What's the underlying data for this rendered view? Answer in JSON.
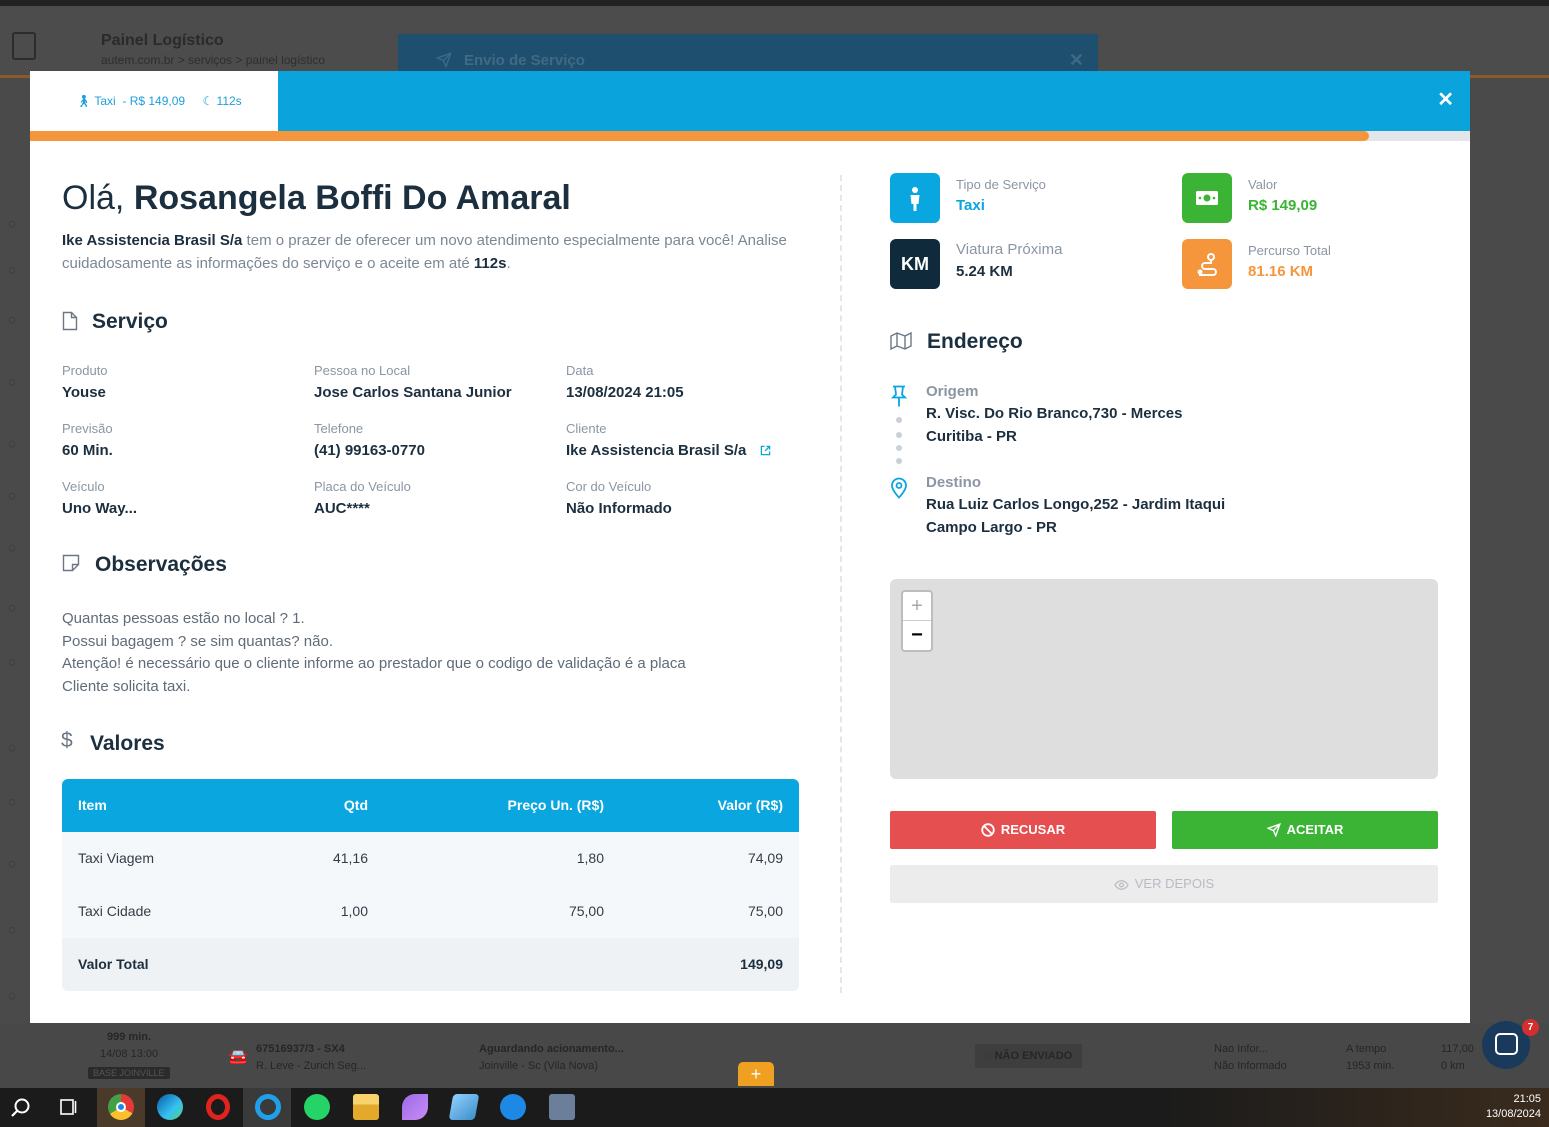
{
  "background": {
    "app_title": "Painel Logístico",
    "breadcrumb": "autem.com.br  >  serviços  >  painel logístico",
    "send_dialog_title": "Envio de Serviço",
    "bottom_row": {
      "time_min": "999 min.",
      "time_date": "14/08 13:00",
      "base_badge": "BASE JOINVILLE",
      "service_code": "67516937/3 - SX4",
      "service_address": "R. Leve - Zurich Seg...",
      "status": "Aguardando acionamento...",
      "city": "Joinville - Sc (Vila Nova)",
      "send_status": "NÃO ENVIADO",
      "info1_a": "Nao Infor...",
      "info1_b": "Não Informado",
      "info2_a": "A tempo",
      "info2_b": "1953 min.",
      "info3_a": "117,00",
      "info3_b": "0 km"
    },
    "chat_unread": "7"
  },
  "modal": {
    "tab": {
      "service": "Taxi",
      "price": "- R$ 149,09",
      "timer": "112s"
    },
    "progress_fraction": 0.93,
    "greeting_prefix": "Olá,",
    "greeting_name": "Rosangela Boffi Do Amaral",
    "intro": {
      "company": "Ike Assistencia Brasil S/a",
      "text": " tem o prazer de oferecer um novo atendimento especialmente para você! Analise cuidadosamente as informações do serviço e o aceite em até ",
      "deadline": "112s",
      "end": "."
    },
    "servico": {
      "title": "Serviço",
      "fields": {
        "produto": {
          "label": "Produto",
          "value": "Youse"
        },
        "pessoa": {
          "label": "Pessoa no Local",
          "value": "Jose Carlos Santana Junior"
        },
        "data": {
          "label": "Data",
          "value": "13/08/2024 21:05"
        },
        "previsao": {
          "label": "Previsão",
          "value": "60 Min."
        },
        "telefone": {
          "label": "Telefone",
          "value": "(41) 99163-0770"
        },
        "cliente": {
          "label": "Cliente",
          "value": "Ike Assistencia Brasil S/a"
        },
        "veiculo": {
          "label": "Veículo",
          "value": "Uno Way..."
        },
        "placa": {
          "label": "Placa do Veículo",
          "value": "AUC****"
        },
        "cor": {
          "label": "Cor do Veículo",
          "value": "Não Informado"
        }
      }
    },
    "observacoes": {
      "title": "Observações",
      "lines": [
        "Quantas pessoas estão no local ? 1.",
        "Possui bagagem ? se sim quantas? não.",
        "Atenção! é necessário que o cliente informe ao prestador que o codigo de validação é a placa",
        "Cliente solicita taxi."
      ]
    },
    "valores": {
      "title": "Valores",
      "headers": {
        "item": "Item",
        "qtd": "Qtd",
        "preco": "Preço Un. (R$)",
        "valor": "Valor (R$)"
      },
      "rows": [
        {
          "item": "Taxi Viagem",
          "qtd": "41,16",
          "preco": "1,80",
          "valor": "74,09"
        },
        {
          "item": "Taxi Cidade",
          "qtd": "1,00",
          "preco": "75,00",
          "valor": "75,00"
        }
      ],
      "total_label": "Valor Total",
      "total_value": "149,09"
    },
    "info_cards": {
      "tipo": {
        "label": "Tipo de Serviço",
        "value": "Taxi",
        "color": "#0aa6e0"
      },
      "valor": {
        "label": "Valor",
        "value": "R$ 149,09",
        "color": "#3bb436"
      },
      "viatura": {
        "label": "Viatura Próxima",
        "value": "5.24 KM",
        "badge_text": "KM",
        "color": "#0f2a3a"
      },
      "percurso": {
        "label": "Percurso Total",
        "value": "81.16 KM",
        "color": "#f5963c"
      }
    },
    "endereco": {
      "title": "Endereço",
      "origem_label": "Origem",
      "origem_line1": "R. Visc. Do Rio Branco,730 - Merces",
      "origem_line2": "Curitiba - PR",
      "destino_label": "Destino",
      "destino_line1": "Rua Luiz Carlos Longo,252 - Jardim Itaqui",
      "destino_line2": "Campo Largo - PR"
    },
    "map": {
      "zoom_in": "+",
      "zoom_out": "−"
    },
    "buttons": {
      "recusar": "RECUSAR",
      "aceitar": "ACEITAR",
      "ver_depois": "VER DEPOIS"
    }
  },
  "taskbar": {
    "time": "21:05",
    "date": "13/08/2024"
  }
}
